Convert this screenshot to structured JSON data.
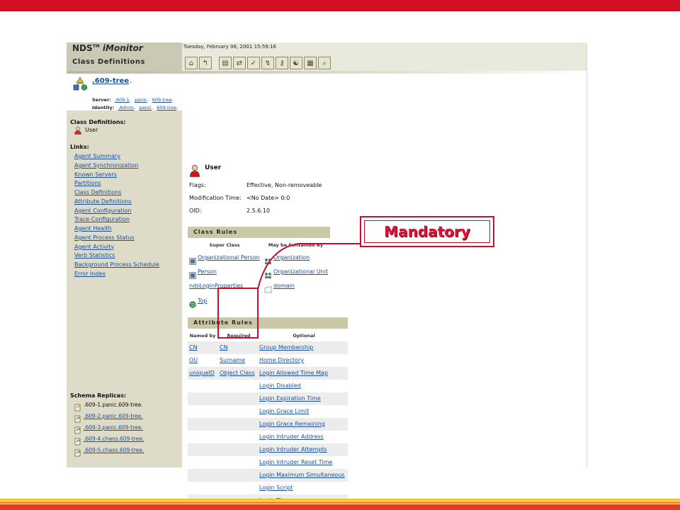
{
  "app": {
    "brand": "NDS",
    "brand_tm": "TM",
    "brand_product": "iMonitor",
    "page_title": "Class Definitions",
    "timestamp": "Tuesday, February 06, 2001 15:59:16"
  },
  "toolbar": {
    "buttons": [
      {
        "name": "toolbar-home-button",
        "glyph": "⌂"
      },
      {
        "name": "toolbar-back-button",
        "glyph": "↰"
      },
      {
        "name": "toolbar-agent-button",
        "glyph": "▤"
      },
      {
        "name": "toolbar-sync-button",
        "glyph": "⇄"
      },
      {
        "name": "toolbar-check-button",
        "glyph": "✓"
      },
      {
        "name": "toolbar-process-button",
        "glyph": "↯"
      },
      {
        "name": "toolbar-key-button",
        "glyph": "⚷"
      },
      {
        "name": "toolbar-options-button",
        "glyph": "☯"
      },
      {
        "name": "toolbar-report-button",
        "glyph": "▦"
      },
      {
        "name": "toolbar-search-button",
        "glyph": "⌕"
      }
    ]
  },
  "tree": {
    "name": ".609-tree",
    "suffix": ".",
    "server_label": "Server:",
    "server_parts": [
      ".609-1",
      "panic",
      "609-tree"
    ],
    "identity_label": "Identity:",
    "identity_parts": [
      ".Admin",
      "panic",
      "609-tree"
    ],
    "sep": ".",
    "end": "."
  },
  "sidebar": {
    "class_defs_label": "Class Definitions:",
    "class_name": "User",
    "links_label": "Links:",
    "links": [
      "Agent Summary",
      "Agent Synchronization",
      "Known Servers",
      "Partitions",
      "Class Definitions",
      "Attribute Definitions",
      "Agent Configuration",
      "Trace Configuration",
      "Agent Health",
      "Agent Process Status",
      "Agent Activity",
      "Verb Statistics",
      "Background Process Schedule",
      "Error Index"
    ],
    "replicas_label": "Schema Replicas:",
    "replicas": [
      {
        "text": ".609-1.panic.609-tree.",
        "link": false
      },
      {
        "text": ".609-2.panic.609-tree.",
        "link": true
      },
      {
        "text": ".609-3.panic.609-tree.",
        "link": true
      },
      {
        "text": ".609-4.chaos.609-tree.",
        "link": true
      },
      {
        "text": ".609-5.chaos.609-tree.",
        "link": true
      }
    ]
  },
  "main": {
    "class_title": "User",
    "flags_label": "Flags:",
    "flags_value": "Effective, Non-removeable",
    "mod_label": "Modification Time:",
    "mod_value": "<No Date> 0:0",
    "oid_label": "OID:",
    "oid_value": "2.5.6.10",
    "class_rules": {
      "title": "Class Rules",
      "col_super": "Super Class",
      "col_contained": "May be Contained By",
      "super": [
        "Organizational Person",
        "Person",
        "ndsLoginProperties",
        "Top"
      ],
      "contained": [
        "Organization",
        "Organizational Unit",
        "domain"
      ]
    },
    "attr_rules": {
      "title": "Attribute Rules",
      "col_named": "Named by",
      "col_required": "Required",
      "col_optional": "Optional",
      "named_by": [
        "CN",
        "OU",
        "uniqueID"
      ],
      "required": [
        "CN",
        "Surname",
        "Object Class"
      ],
      "optional": [
        "Group Membership",
        "Home Directory",
        "Login Allowed Time Map",
        "Login Disabled",
        "Login Expiration Time",
        "Login Grace Limit",
        "Login Grace Remaining",
        "Login Intruder Address",
        "Login Intruder Attempts",
        "Login Intruder Reset Time",
        "Login Maximum Simultaneous",
        "Login Script",
        "Login Time"
      ]
    }
  },
  "annotation": {
    "label": "Mandatory"
  },
  "colors": {
    "brand_red": "#d50f23",
    "annotation_red": "#c8102e",
    "sidebar_bg": "#dedbc8",
    "section_head": "#cac9a7",
    "link": "#1a4f9c"
  }
}
